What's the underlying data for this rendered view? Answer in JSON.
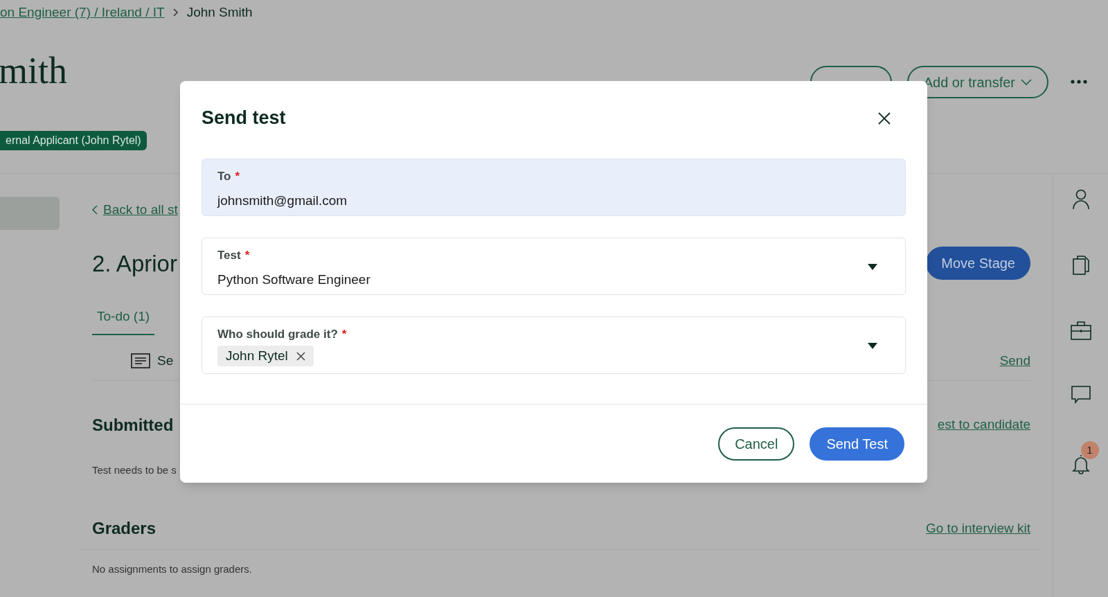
{
  "breadcrumb": {
    "link": "on Engineer (7) / Ireland / IT",
    "current": "John Smith"
  },
  "candidate": {
    "name": "mith",
    "badge": "ernal Applicant (John Rytel)"
  },
  "header_actions": [
    {
      "kind": "covered"
    },
    {
      "kind": "dropdown",
      "label": "Add or transfer"
    }
  ],
  "back_link": "Back to all st",
  "stage": {
    "title": "2. Aprior",
    "action": "Move Stage"
  },
  "tabs": [
    {
      "label": "To-do (1)",
      "selected": true
    }
  ],
  "todo_rows": [
    {
      "text": "Se",
      "action": "Send"
    }
  ],
  "sections": [
    {
      "title": "Submitted",
      "link": "est to candidate",
      "note": "Test needs to be s"
    },
    {
      "title": "Graders",
      "link": "Go to interview kit",
      "note": "No assignments to assign graders."
    }
  ],
  "rail": {
    "notification_count": "1"
  },
  "dialog": {
    "title": "Send test",
    "fields": [
      {
        "kind": "text",
        "label": "To",
        "required_mark": "*",
        "value": "johnsmith@gmail.com",
        "focused": true
      },
      {
        "kind": "select",
        "label": "Test",
        "required_mark": "*",
        "value": "Python Software Engineer",
        "focused": false
      },
      {
        "kind": "multiselect",
        "label": "Who should grade it?",
        "required_mark": "*",
        "chips": [
          "John Rytel"
        ],
        "focused": false
      }
    ],
    "buttons": [
      {
        "kind": "secondary",
        "label": "Cancel"
      },
      {
        "kind": "primary",
        "label": "Send Test"
      }
    ]
  }
}
